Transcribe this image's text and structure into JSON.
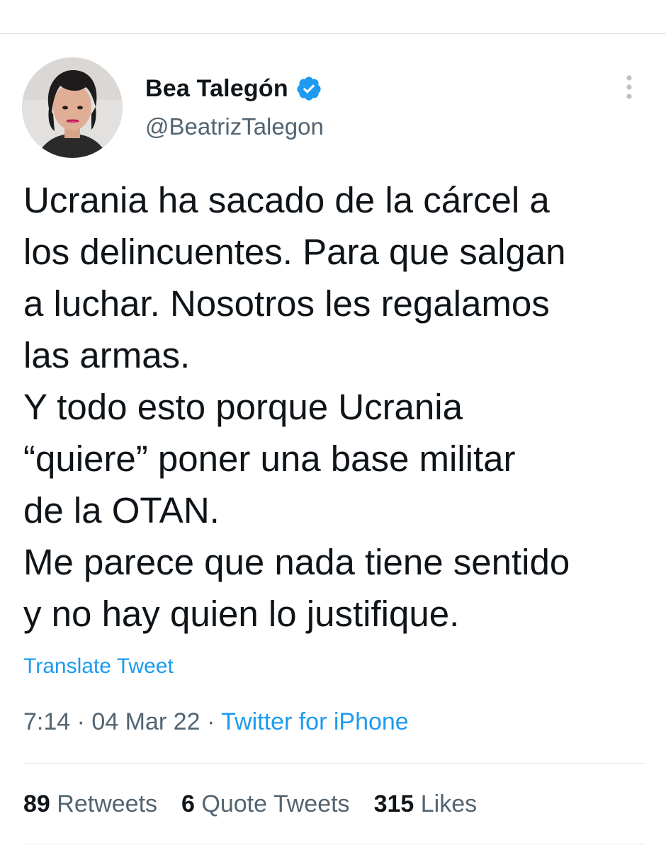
{
  "author": {
    "display_name": "Bea Talegón",
    "handle": "@BeatrizTalegon",
    "verified": true,
    "verified_icon": "verified-badge-icon",
    "avatar_icon": "profile-photo"
  },
  "tweet": {
    "lines": [
      "Ucrania ha sacado de la cárcel a",
      "los delincuentes. Para que salgan",
      "a luchar. Nosotros les regalamos",
      "las armas.",
      "Y todo esto porque Ucrania",
      "“quiere” poner una base militar",
      "de la OTAN.",
      "Me parece que nada tiene sentido",
      "y no hay quien lo justifique."
    ],
    "translate_label": "Translate Tweet"
  },
  "meta": {
    "time": "7:14",
    "separator": "·",
    "date": "04 Mar 22",
    "source": "Twitter for iPhone"
  },
  "stats": {
    "retweets_count": "89",
    "retweets_label": "Retweets",
    "quotes_count": "6",
    "quotes_label": "Quote Tweets",
    "likes_count": "315",
    "likes_label": "Likes"
  },
  "colors": {
    "link_blue": "#1d9bf0",
    "text_primary": "#0f1419",
    "text_secondary": "#536471",
    "divider": "#e1e6ea"
  }
}
